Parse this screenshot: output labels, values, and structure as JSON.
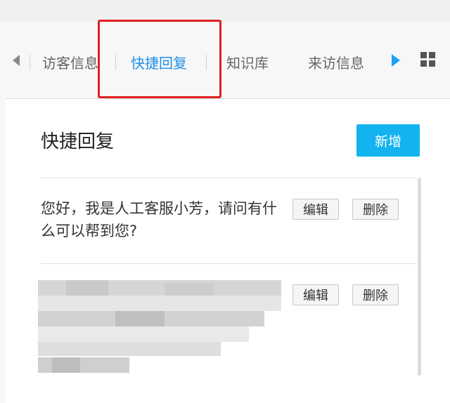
{
  "tabs": [
    {
      "label": "访客信息",
      "active": false
    },
    {
      "label": "快捷回复",
      "active": true
    },
    {
      "label": "知识库",
      "active": false
    },
    {
      "label": "来访信息",
      "active": false
    }
  ],
  "panel": {
    "title": "快捷回复",
    "add_label": "新增"
  },
  "replies": [
    {
      "text": "您好，我是人工客服小芳，请问有什么可以帮到您?",
      "edit_label": "编辑",
      "delete_label": "删除"
    },
    {
      "text": "",
      "redacted": true,
      "edit_label": "编辑",
      "delete_label": "删除"
    }
  ],
  "colors": {
    "accent": "#1e8fe8",
    "add_button": "#12b3ee",
    "highlight": "#e02020"
  }
}
